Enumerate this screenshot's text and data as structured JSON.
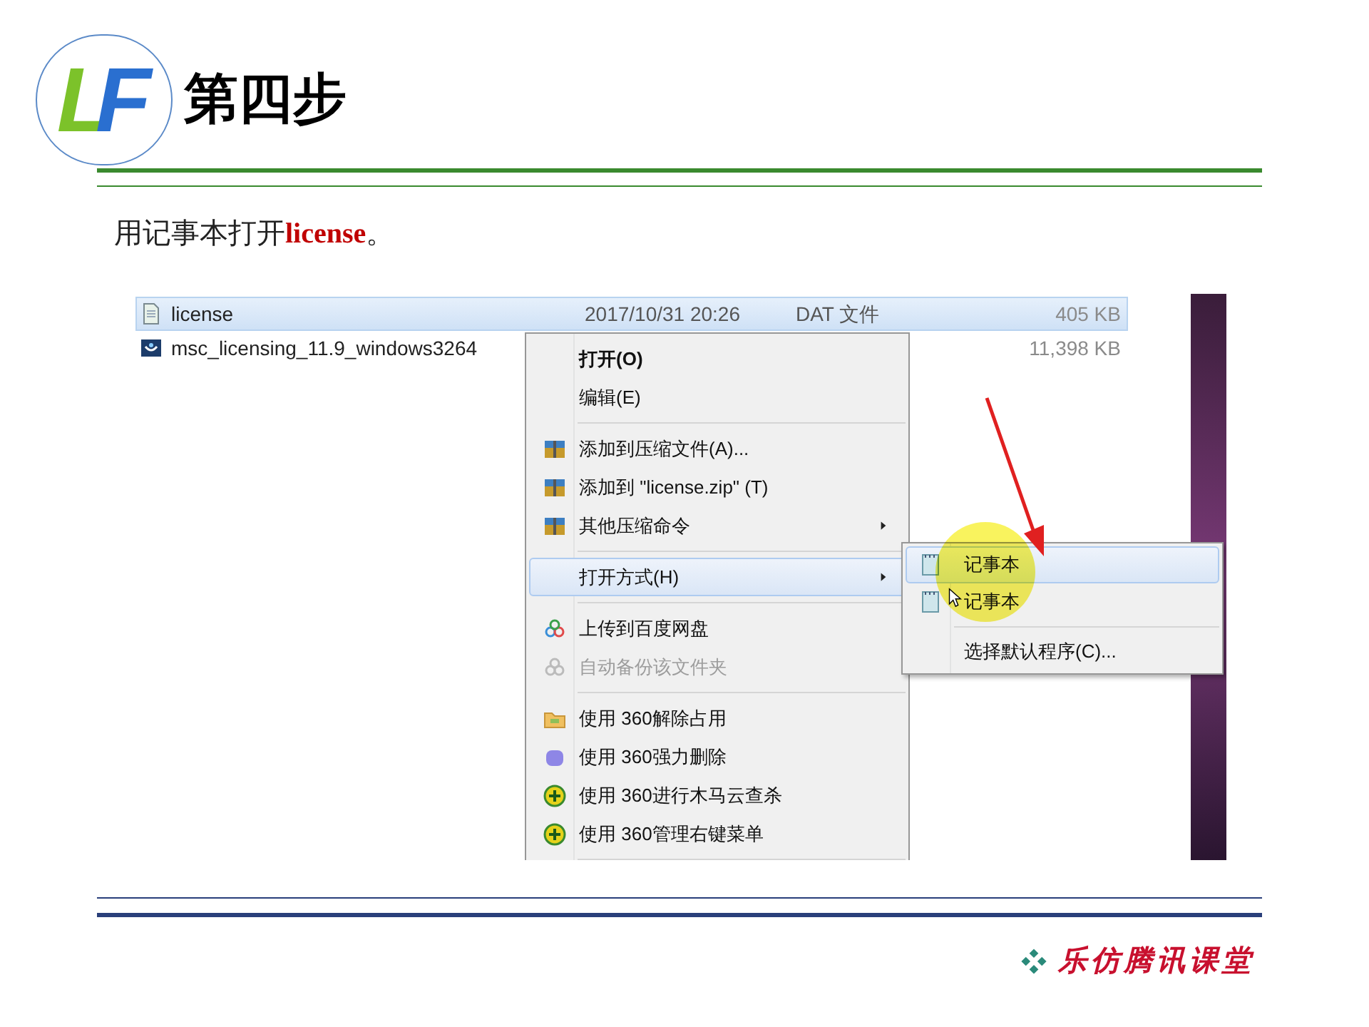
{
  "slide": {
    "logo_text": "LF",
    "title": "第四步",
    "instruction": "用记事本打开**license**。"
  },
  "files": [
    {
      "kind": "text",
      "name": "license",
      "date": "2017/10/31 20:26",
      "type": "DAT 文件",
      "size": "405 KB",
      "selected": true
    },
    {
      "kind": "app",
      "name": "msc_licensing_11.9_windows3264",
      "size": "11,398 KB",
      "selected": false
    }
  ],
  "context_menu": [
    {
      "kind": "item",
      "label": "打开(O)",
      "bold": true,
      "disabled": false,
      "submenu": false,
      "highlighted": false
    },
    {
      "kind": "item",
      "label": "编辑(E)",
      "bold": false,
      "disabled": false,
      "submenu": false,
      "highlighted": false
    },
    {
      "kind": "separator"
    },
    {
      "kind": "archive",
      "label": "添加到压缩文件(A)...",
      "bold": false,
      "disabled": false,
      "submenu": false,
      "highlighted": false
    },
    {
      "kind": "archive",
      "label": "添加到 \"license.zip\" (T)",
      "bold": false,
      "disabled": false,
      "submenu": false,
      "highlighted": false
    },
    {
      "kind": "archive",
      "label": "其他压缩命令",
      "bold": false,
      "disabled": false,
      "submenu": true,
      "highlighted": false
    },
    {
      "kind": "separator"
    },
    {
      "kind": "item",
      "label": "打开方式(H)",
      "bold": false,
      "disabled": false,
      "submenu": true,
      "highlighted": true
    },
    {
      "kind": "separator"
    },
    {
      "kind": "cloud",
      "label": "上传到百度网盘",
      "bold": false,
      "disabled": false,
      "submenu": false,
      "highlighted": false
    },
    {
      "kind": "cloud",
      "label": "自动备份该文件夹",
      "bold": false,
      "disabled": true,
      "submenu": false,
      "highlighted": false
    },
    {
      "kind": "separator"
    },
    {
      "kind": "folder",
      "label": "使用 360解除占用",
      "bold": false,
      "disabled": false,
      "submenu": false,
      "highlighted": false
    },
    {
      "kind": "blob",
      "label": "使用 360强力删除",
      "bold": false,
      "disabled": false,
      "submenu": false,
      "highlighted": false
    },
    {
      "kind": "plus",
      "label": "使用 360进行木马云查杀",
      "bold": false,
      "disabled": false,
      "submenu": false,
      "highlighted": false
    },
    {
      "kind": "plus",
      "label": "使用 360管理右键菜单",
      "bold": false,
      "disabled": false,
      "submenu": false,
      "highlighted": false
    },
    {
      "kind": "separator"
    }
  ],
  "open_with_menu": [
    {
      "kind": "app",
      "label": "记事本",
      "highlighted": true
    },
    {
      "kind": "app",
      "label": "记事本",
      "highlighted": false
    },
    {
      "kind": "separator"
    },
    {
      "kind": "plain",
      "label": "选择默认程序(C)...",
      "highlighted": false
    }
  ],
  "footer": {
    "brand": "乐仿腾讯课堂"
  }
}
